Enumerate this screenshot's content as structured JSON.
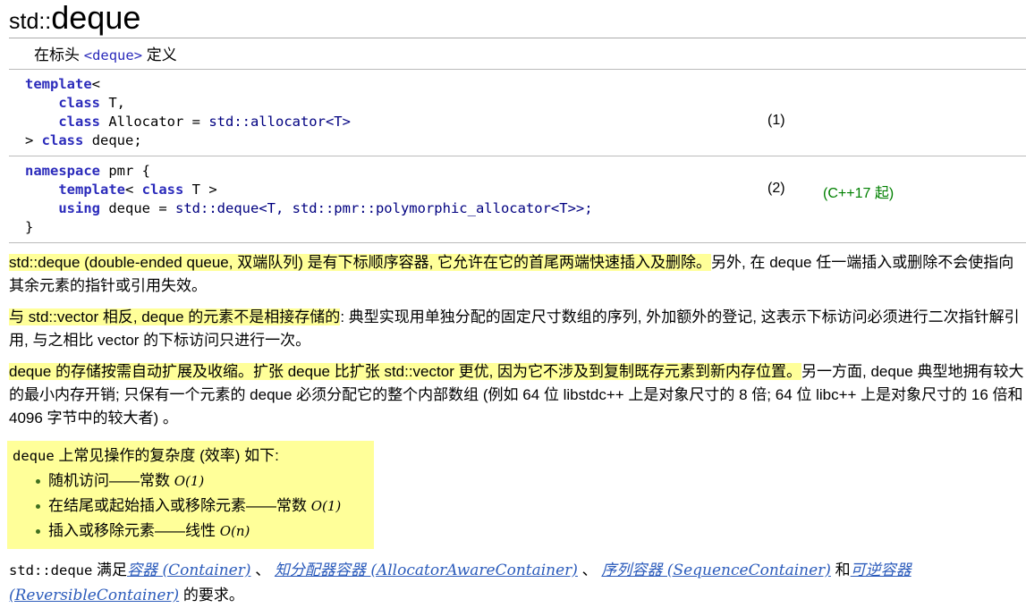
{
  "title": {
    "namespace": "std::",
    "name": "deque"
  },
  "header": {
    "prefix": "在标头 ",
    "include": "<deque>",
    "suffix": " 定义"
  },
  "declarations": [
    {
      "code_lines": [
        "template<",
        "    class T,",
        "    class Allocator = std::allocator<T>",
        "> class deque;"
      ],
      "number": "(1)",
      "since": ""
    },
    {
      "code_lines": [
        "namespace pmr {",
        "    template< class T >",
        "    using deque = std::deque<T, std::pmr::polymorphic_allocator<T>>;",
        "}"
      ],
      "number": "(2)",
      "since": "(C++17 起)"
    }
  ],
  "paragraphs": [
    {
      "highlight": "std::deque (double-ended queue, 双端队列) 是有下标顺序容器, 它允许在它的首尾两端快速插入及删除。",
      "rest": "另外, 在 deque 任一端插入或删除不会使指向其余元素的指针或引用失效。"
    },
    {
      "highlight": "与 std::vector 相反, deque 的元素不是相接存储的",
      "rest": ": 典型实现用单独分配的固定尺寸数组的序列, 外加额外的登记, 这表示下标访问必须进行二次指针解引用, 与之相比 vector 的下标访问只进行一次。"
    },
    {
      "highlight": "deque 的存储按需自动扩展及收缩。扩张 deque 比扩张 std::vector 更优, 因为它不涉及到复制既存元素到新内存位置。",
      "rest": "另一方面, deque 典型地拥有较大的最小内存开销; 只保有一个元素的 deque 必须分配它的整个内部数组 (例如 64 位 libstdc++ 上是对象尺寸的 8 倍; 64 位 libc++ 上是对象尺寸的 16 倍和 4096 字节中的较大者) 。"
    }
  ],
  "complexity": {
    "intro_mono": "deque",
    "intro_rest": " 上常见操作的复杂度 (效率) 如下:",
    "items": [
      {
        "text": "随机访问——常数 ",
        "bigo": "O(1)"
      },
      {
        "text": "在结尾或起始插入或移除元素——常数 ",
        "bigo": "O(1)"
      },
      {
        "text": "插入或移除元素——线性 ",
        "bigo": "O(n)"
      }
    ]
  },
  "requirements": {
    "lead_mono": "std::deque",
    "lead_text": " 满足",
    "links": [
      "容器 (Container)",
      "知分配器容器 (AllocatorAwareContainer)",
      "序列容器 (SequenceContainer)",
      "可逆容器 (ReversibleContainer)"
    ],
    "sep1": " 、 ",
    "sep2": " 、 ",
    "sep3": " 和",
    "tail": " 的要求。"
  },
  "colors": {
    "highlight": "#ffff99",
    "code": "#000080",
    "keyword": "#2b2bbb",
    "link": "#2b5bbb",
    "since": "#008000",
    "bullet": "#3f6f1f"
  }
}
